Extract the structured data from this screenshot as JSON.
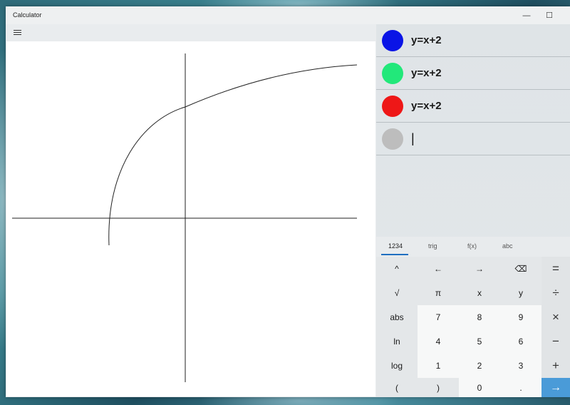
{
  "window": {
    "title": "Calculator",
    "minimize_glyph": "—",
    "maximize_glyph": "☐"
  },
  "menu": {
    "icon": "hamburger-menu-icon"
  },
  "functions": [
    {
      "expression": "y=x+2",
      "color": "#0a14e6"
    },
    {
      "expression": "y=x+2",
      "color": "#22e87a"
    },
    {
      "expression": "y=x+2",
      "color": "#ee1717"
    },
    {
      "expression": "|",
      "color": "#bdbdbd"
    }
  ],
  "keypad": {
    "tabs": [
      "1234",
      "trig",
      "f(x)",
      "abc"
    ],
    "active_tab": "1234",
    "rows": [
      [
        "^",
        "←",
        "→",
        "⌫",
        "="
      ],
      [
        "√",
        "π",
        "x",
        "y",
        "÷"
      ],
      [
        "abs",
        "7",
        "8",
        "9",
        "×"
      ],
      [
        "ln",
        "4",
        "5",
        "6",
        "−"
      ],
      [
        "log",
        "1",
        "2",
        "3",
        "+"
      ],
      [
        "(",
        ")",
        "0",
        ".",
        "→"
      ]
    ]
  },
  "graph": {
    "curve_color": "#222222",
    "axis_color": "#222222"
  }
}
